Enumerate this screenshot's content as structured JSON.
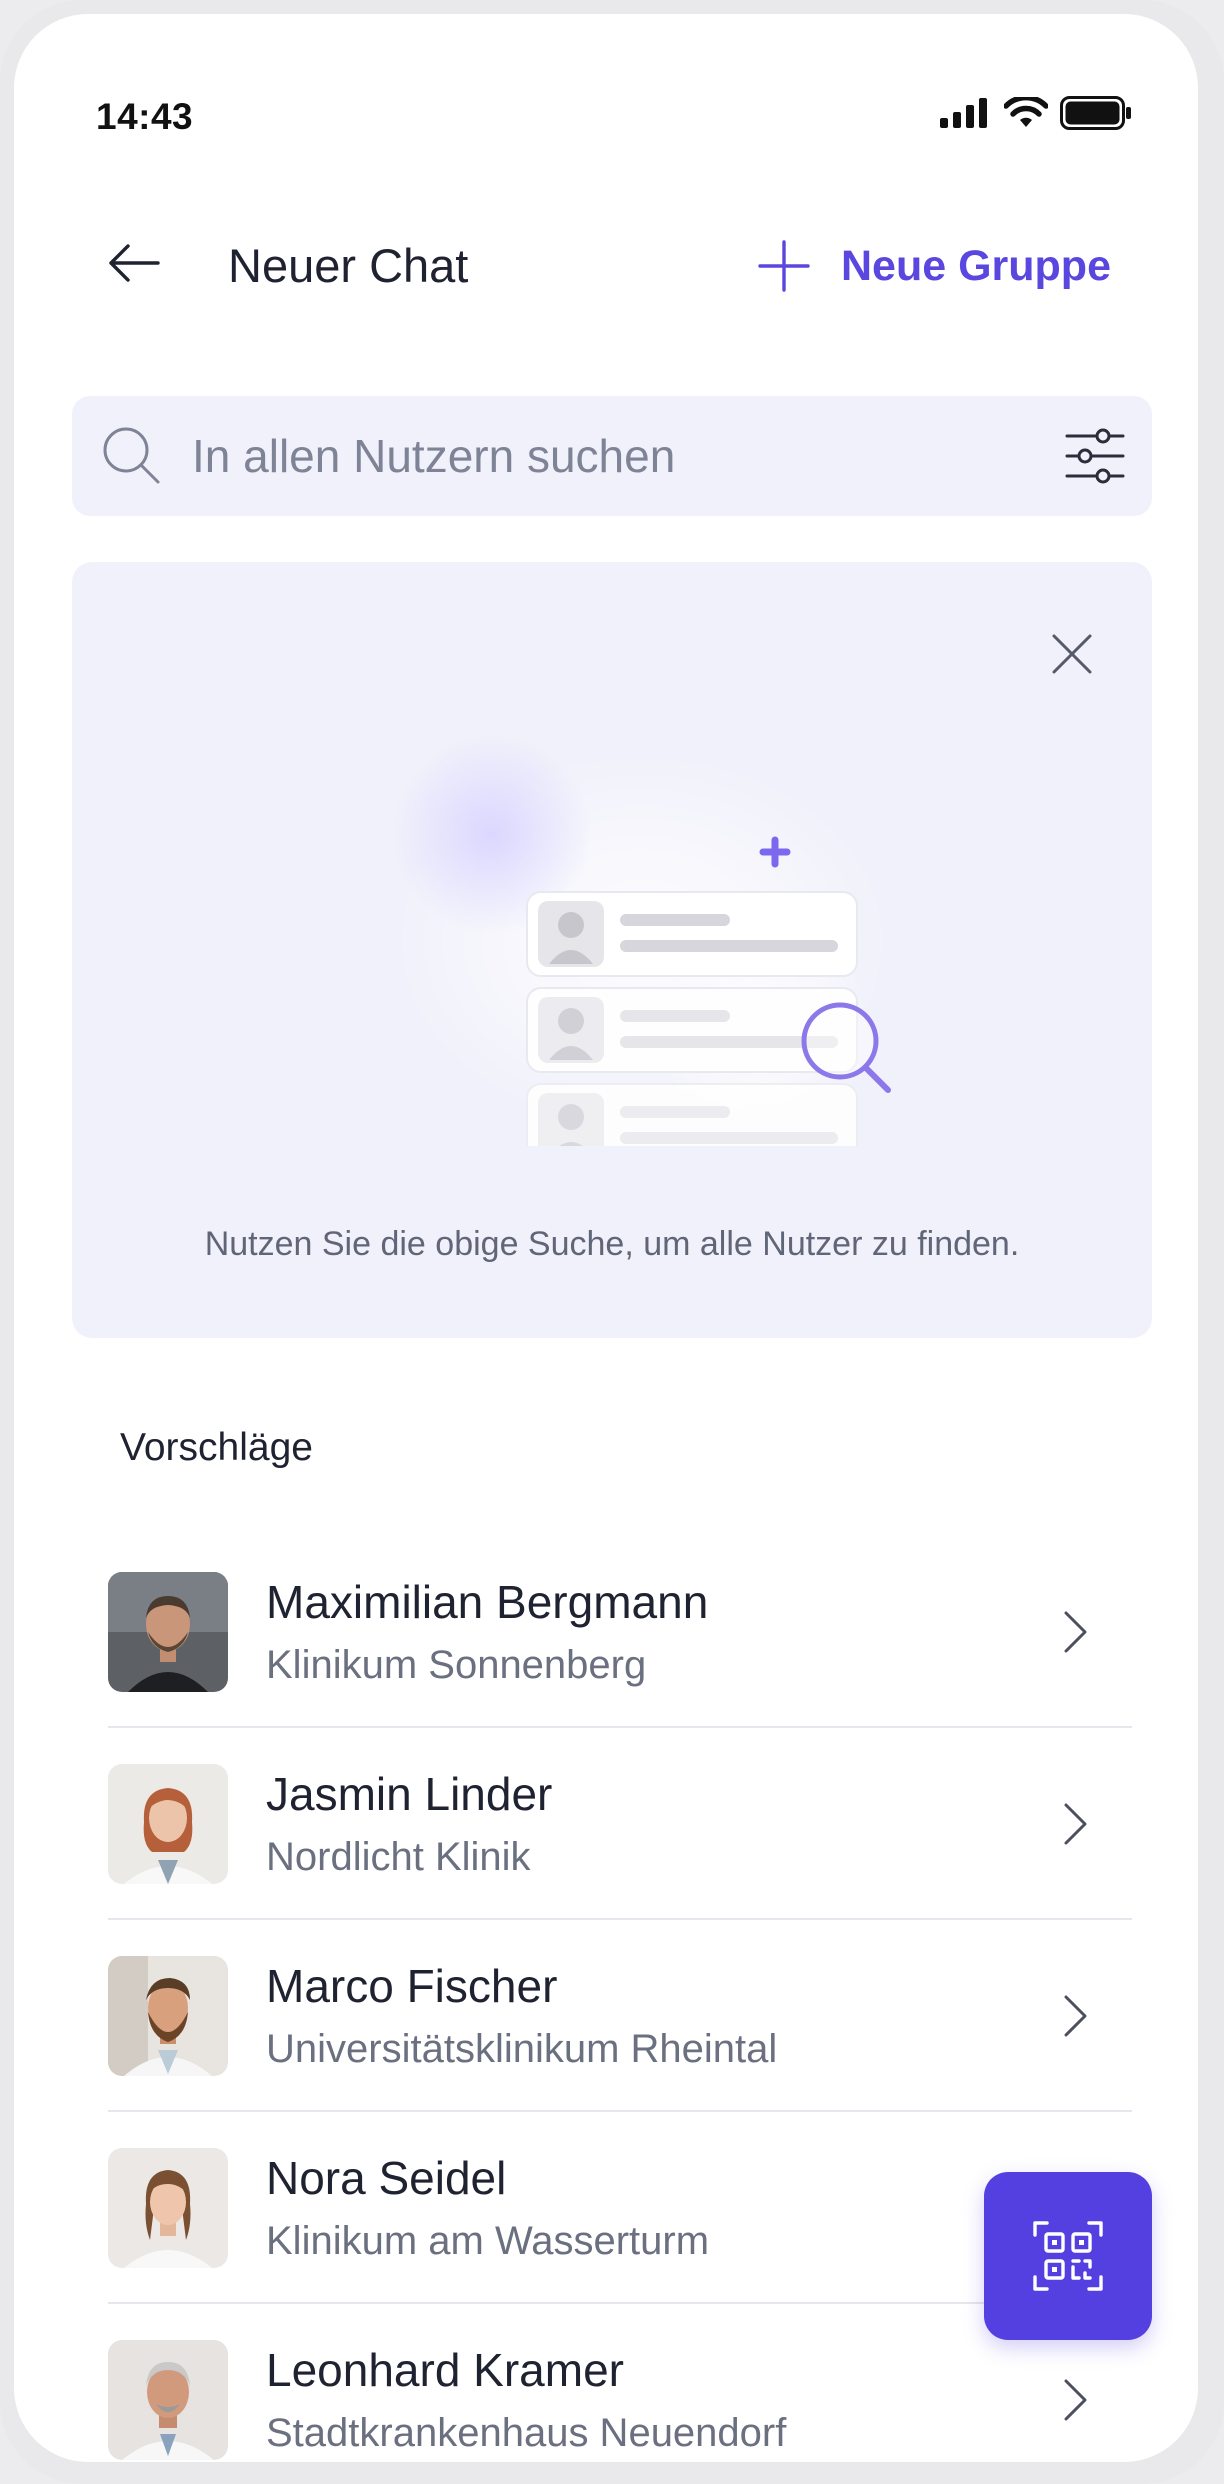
{
  "status_bar": {
    "time": "14:43"
  },
  "header": {
    "title": "Neuer Chat",
    "new_group_label": "Neue Gruppe",
    "back_icon": "arrow-left-icon",
    "add_icon": "plus-icon"
  },
  "search": {
    "placeholder": "In allen Nutzern suchen",
    "icon": "search-icon",
    "filter_icon": "sliders-icon"
  },
  "empty_state": {
    "hint": "Nutzen Sie die obige Suche, um alle Nutzer zu finden.",
    "close_icon": "close-icon"
  },
  "suggestions": {
    "title": "Vorschläge",
    "items": [
      {
        "name": "Maximilian Bergmann",
        "org": "Klinikum Sonnenberg"
      },
      {
        "name": "Jasmin Linder",
        "org": "Nordlicht Klinik"
      },
      {
        "name": "Marco Fischer",
        "org": "Universitätsklinikum Rheintal"
      },
      {
        "name": "Nora Seidel",
        "org": "Klinikum am Wasserturm"
      },
      {
        "name": "Leonhard Kramer",
        "org": "Stadtkrankenhaus Neuendorf"
      }
    ]
  },
  "fab": {
    "icon": "qr-code-icon"
  },
  "colors": {
    "accent": "#5440e0",
    "accent_text": "#5a47e0",
    "card_bg": "#f1f1fb",
    "text_primary": "#1f2230",
    "text_secondary": "#6b7080"
  }
}
